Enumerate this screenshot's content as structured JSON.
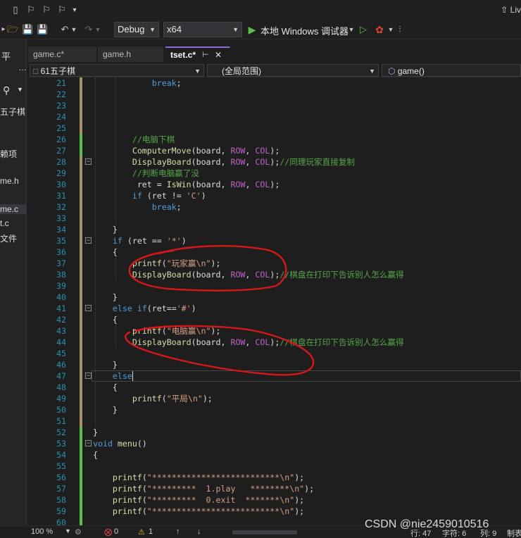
{
  "title_bar": {
    "live_share_label": "Liv"
  },
  "toolbar": {
    "config": "Debug",
    "platform": "x64",
    "debugger_label": "本地 Windows 调试器"
  },
  "left_pane": {
    "items": [
      {
        "label": "五子棋",
        "selected": false
      },
      {
        "label": "赖项",
        "selected": false
      },
      {
        "label": "me.h",
        "selected": false
      },
      {
        "label": "me.c",
        "selected": true
      },
      {
        "label": "t.c",
        "selected": false
      },
      {
        "label": "文件",
        "selected": false
      }
    ]
  },
  "tabs": [
    {
      "label": "game.c*",
      "active": false
    },
    {
      "label": "game.h",
      "active": false
    },
    {
      "label": "tset.c*",
      "active": true
    }
  ],
  "navbar": {
    "project": "61五子棋",
    "scope": "(全局范围)",
    "member": "game()"
  },
  "editor": {
    "lines": [
      {
        "n": "21",
        "code": "            break;"
      },
      {
        "n": "22",
        "code": ""
      },
      {
        "n": "23",
        "code": ""
      },
      {
        "n": "24",
        "code": ""
      },
      {
        "n": "25",
        "code": ""
      },
      {
        "n": "26",
        "code": "        //电脑下棋"
      },
      {
        "n": "27",
        "code": "        ComputerMove(board, ROW, COL);"
      },
      {
        "n": "28",
        "code": "        DisplayBoard(board, ROW, COL);//同理玩家直接复制"
      },
      {
        "n": "29",
        "code": "        //判断电脑赢了没"
      },
      {
        "n": "30",
        "code": "         ret = IsWin(board, ROW, COL);"
      },
      {
        "n": "31",
        "code": "        if (ret != 'C')"
      },
      {
        "n": "32",
        "code": "            break;"
      },
      {
        "n": "33",
        "code": ""
      },
      {
        "n": "34",
        "code": "    }"
      },
      {
        "n": "35",
        "code": "    if (ret == '*')"
      },
      {
        "n": "36",
        "code": "    {"
      },
      {
        "n": "37",
        "code": "        printf(\"玩家赢\\n\");"
      },
      {
        "n": "38",
        "code": "        DisplayBoard(board, ROW, COL);//棋盘在打印下告诉别人怎么赢得"
      },
      {
        "n": "39",
        "code": ""
      },
      {
        "n": "40",
        "code": "    }"
      },
      {
        "n": "41",
        "code": "    else if(ret=='#')"
      },
      {
        "n": "42",
        "code": "    {"
      },
      {
        "n": "43",
        "code": "        printf(\"电脑赢\\n\");"
      },
      {
        "n": "44",
        "code": "        DisplayBoard(board, ROW, COL);//棋盘在打印下告诉别人怎么赢得"
      },
      {
        "n": "45",
        "code": ""
      },
      {
        "n": "46",
        "code": "    }"
      },
      {
        "n": "47",
        "code": "    else"
      },
      {
        "n": "48",
        "code": "    {"
      },
      {
        "n": "49",
        "code": "        printf(\"平局\\n\");"
      },
      {
        "n": "50",
        "code": "    }"
      },
      {
        "n": "51",
        "code": ""
      },
      {
        "n": "52",
        "code": "}"
      },
      {
        "n": "53",
        "code": "void menu()"
      },
      {
        "n": "54",
        "code": "{"
      },
      {
        "n": "55",
        "code": ""
      },
      {
        "n": "56",
        "code": "    printf(\"**************************\\n\");"
      },
      {
        "n": "57",
        "code": "    printf(\"*********  1.play   ********\\n\");"
      },
      {
        "n": "58",
        "code": "    printf(\"*********  0.exit  *******\\n\");"
      },
      {
        "n": "59",
        "code": "    printf(\"**************************\\n\");"
      },
      {
        "n": "60",
        "code": ""
      }
    ]
  },
  "status_bar": {
    "zoom": "100 %",
    "errors": "0",
    "warnings": "1",
    "line": "行: 47",
    "char": "字符: 6",
    "col": "列: 9",
    "tab_mode": "制表"
  },
  "watermark": "CSDN @nie2459010516",
  "colors": {
    "keyword": "#569cd6",
    "function": "#dcdcaa",
    "string": "#d69d85",
    "comment": "#57a64a",
    "macro": "#bd63c5",
    "line_number": "#2b91af",
    "annotation": "#e0201c"
  }
}
